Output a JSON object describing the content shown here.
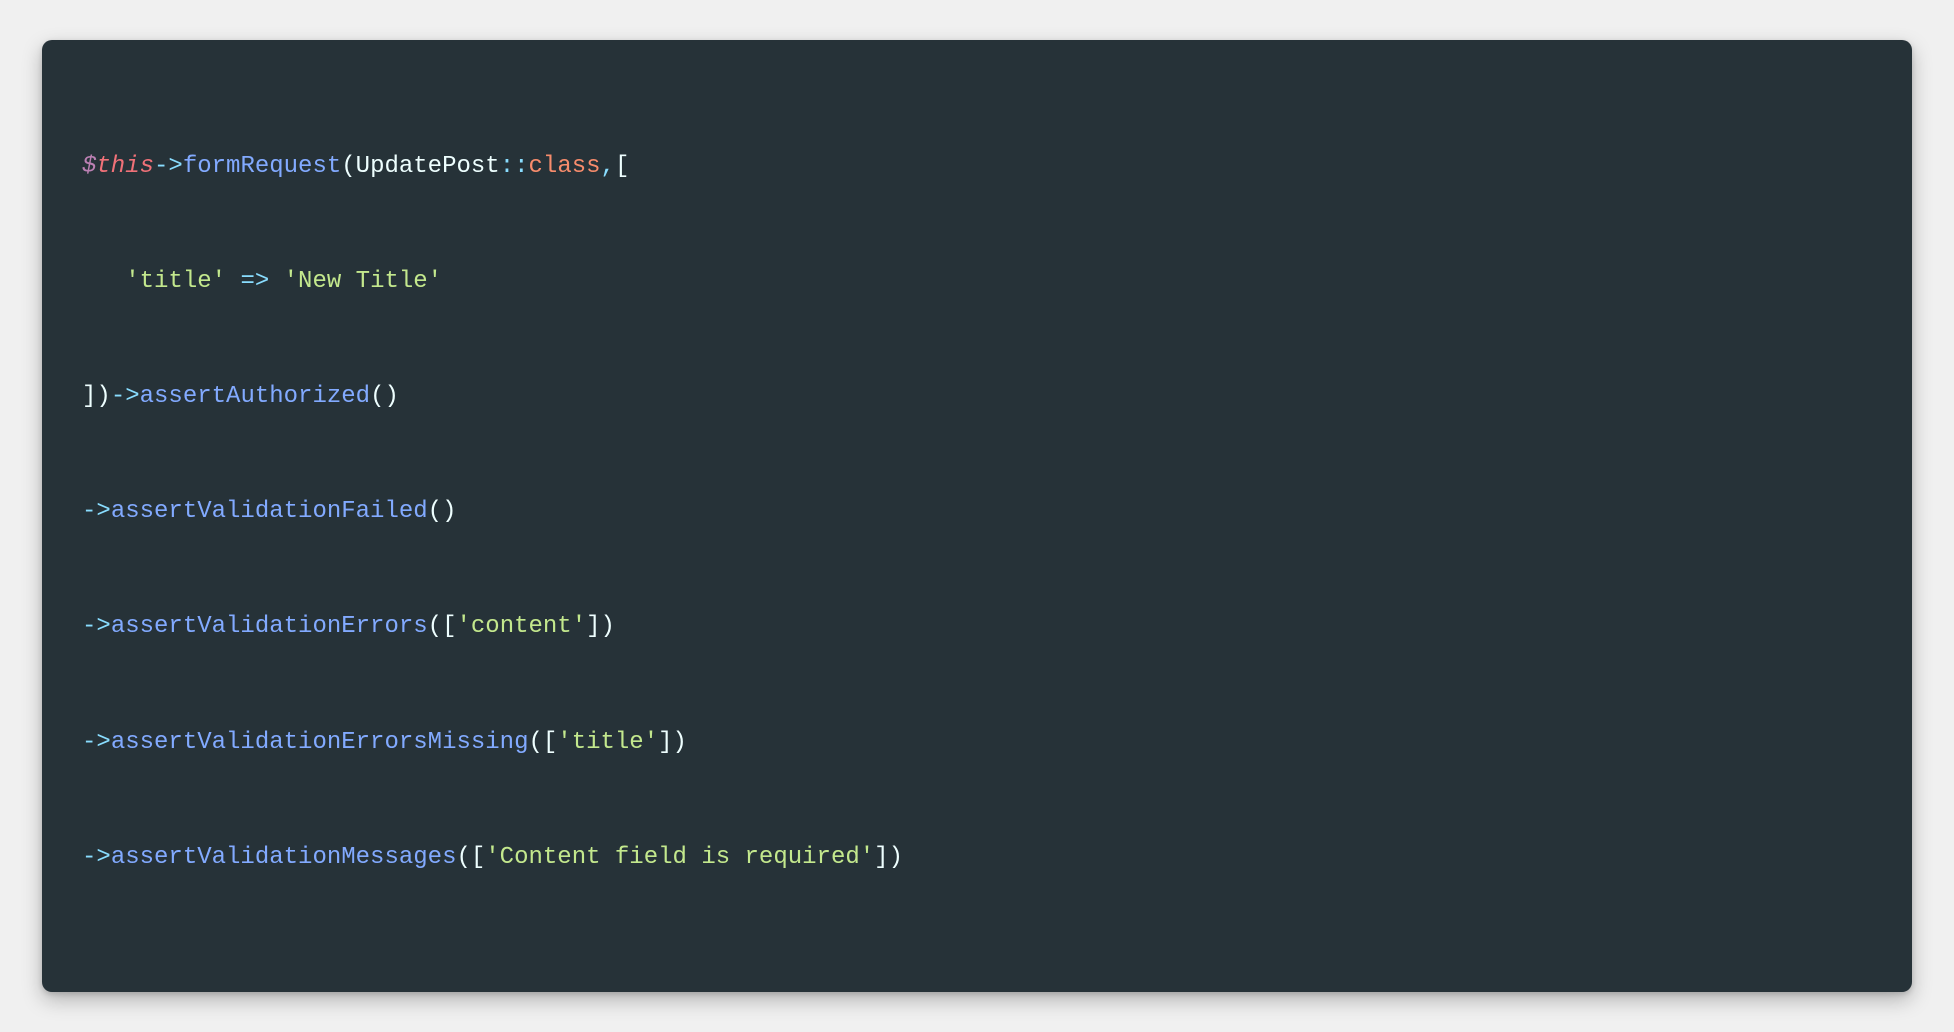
{
  "code": {
    "dollar": "$",
    "this": "this",
    "arrow": "->",
    "formRequest": "formRequest",
    "openParen": "(",
    "closeParen": ")",
    "updatePost": "UpdatePost",
    "doubleColon": "::",
    "classKw": "class",
    "comma": ",",
    "openBracket": "[",
    "closeBracket": "]",
    "titleKey": "'title'",
    "fatArrow": "=>",
    "titleValue": "'New Title'",
    "assertAuthorized": "assertAuthorized",
    "assertValidationFailed": "assertValidationFailed",
    "assertValidationErrors": "assertValidationErrors",
    "contentStr": "'content'",
    "assertValidationErrorsMissing": "assertValidationErrorsMissing",
    "titleStr": "'title'",
    "assertValidationMessages": "assertValidationMessages",
    "contentFieldRequired": "'Content field is required'"
  }
}
